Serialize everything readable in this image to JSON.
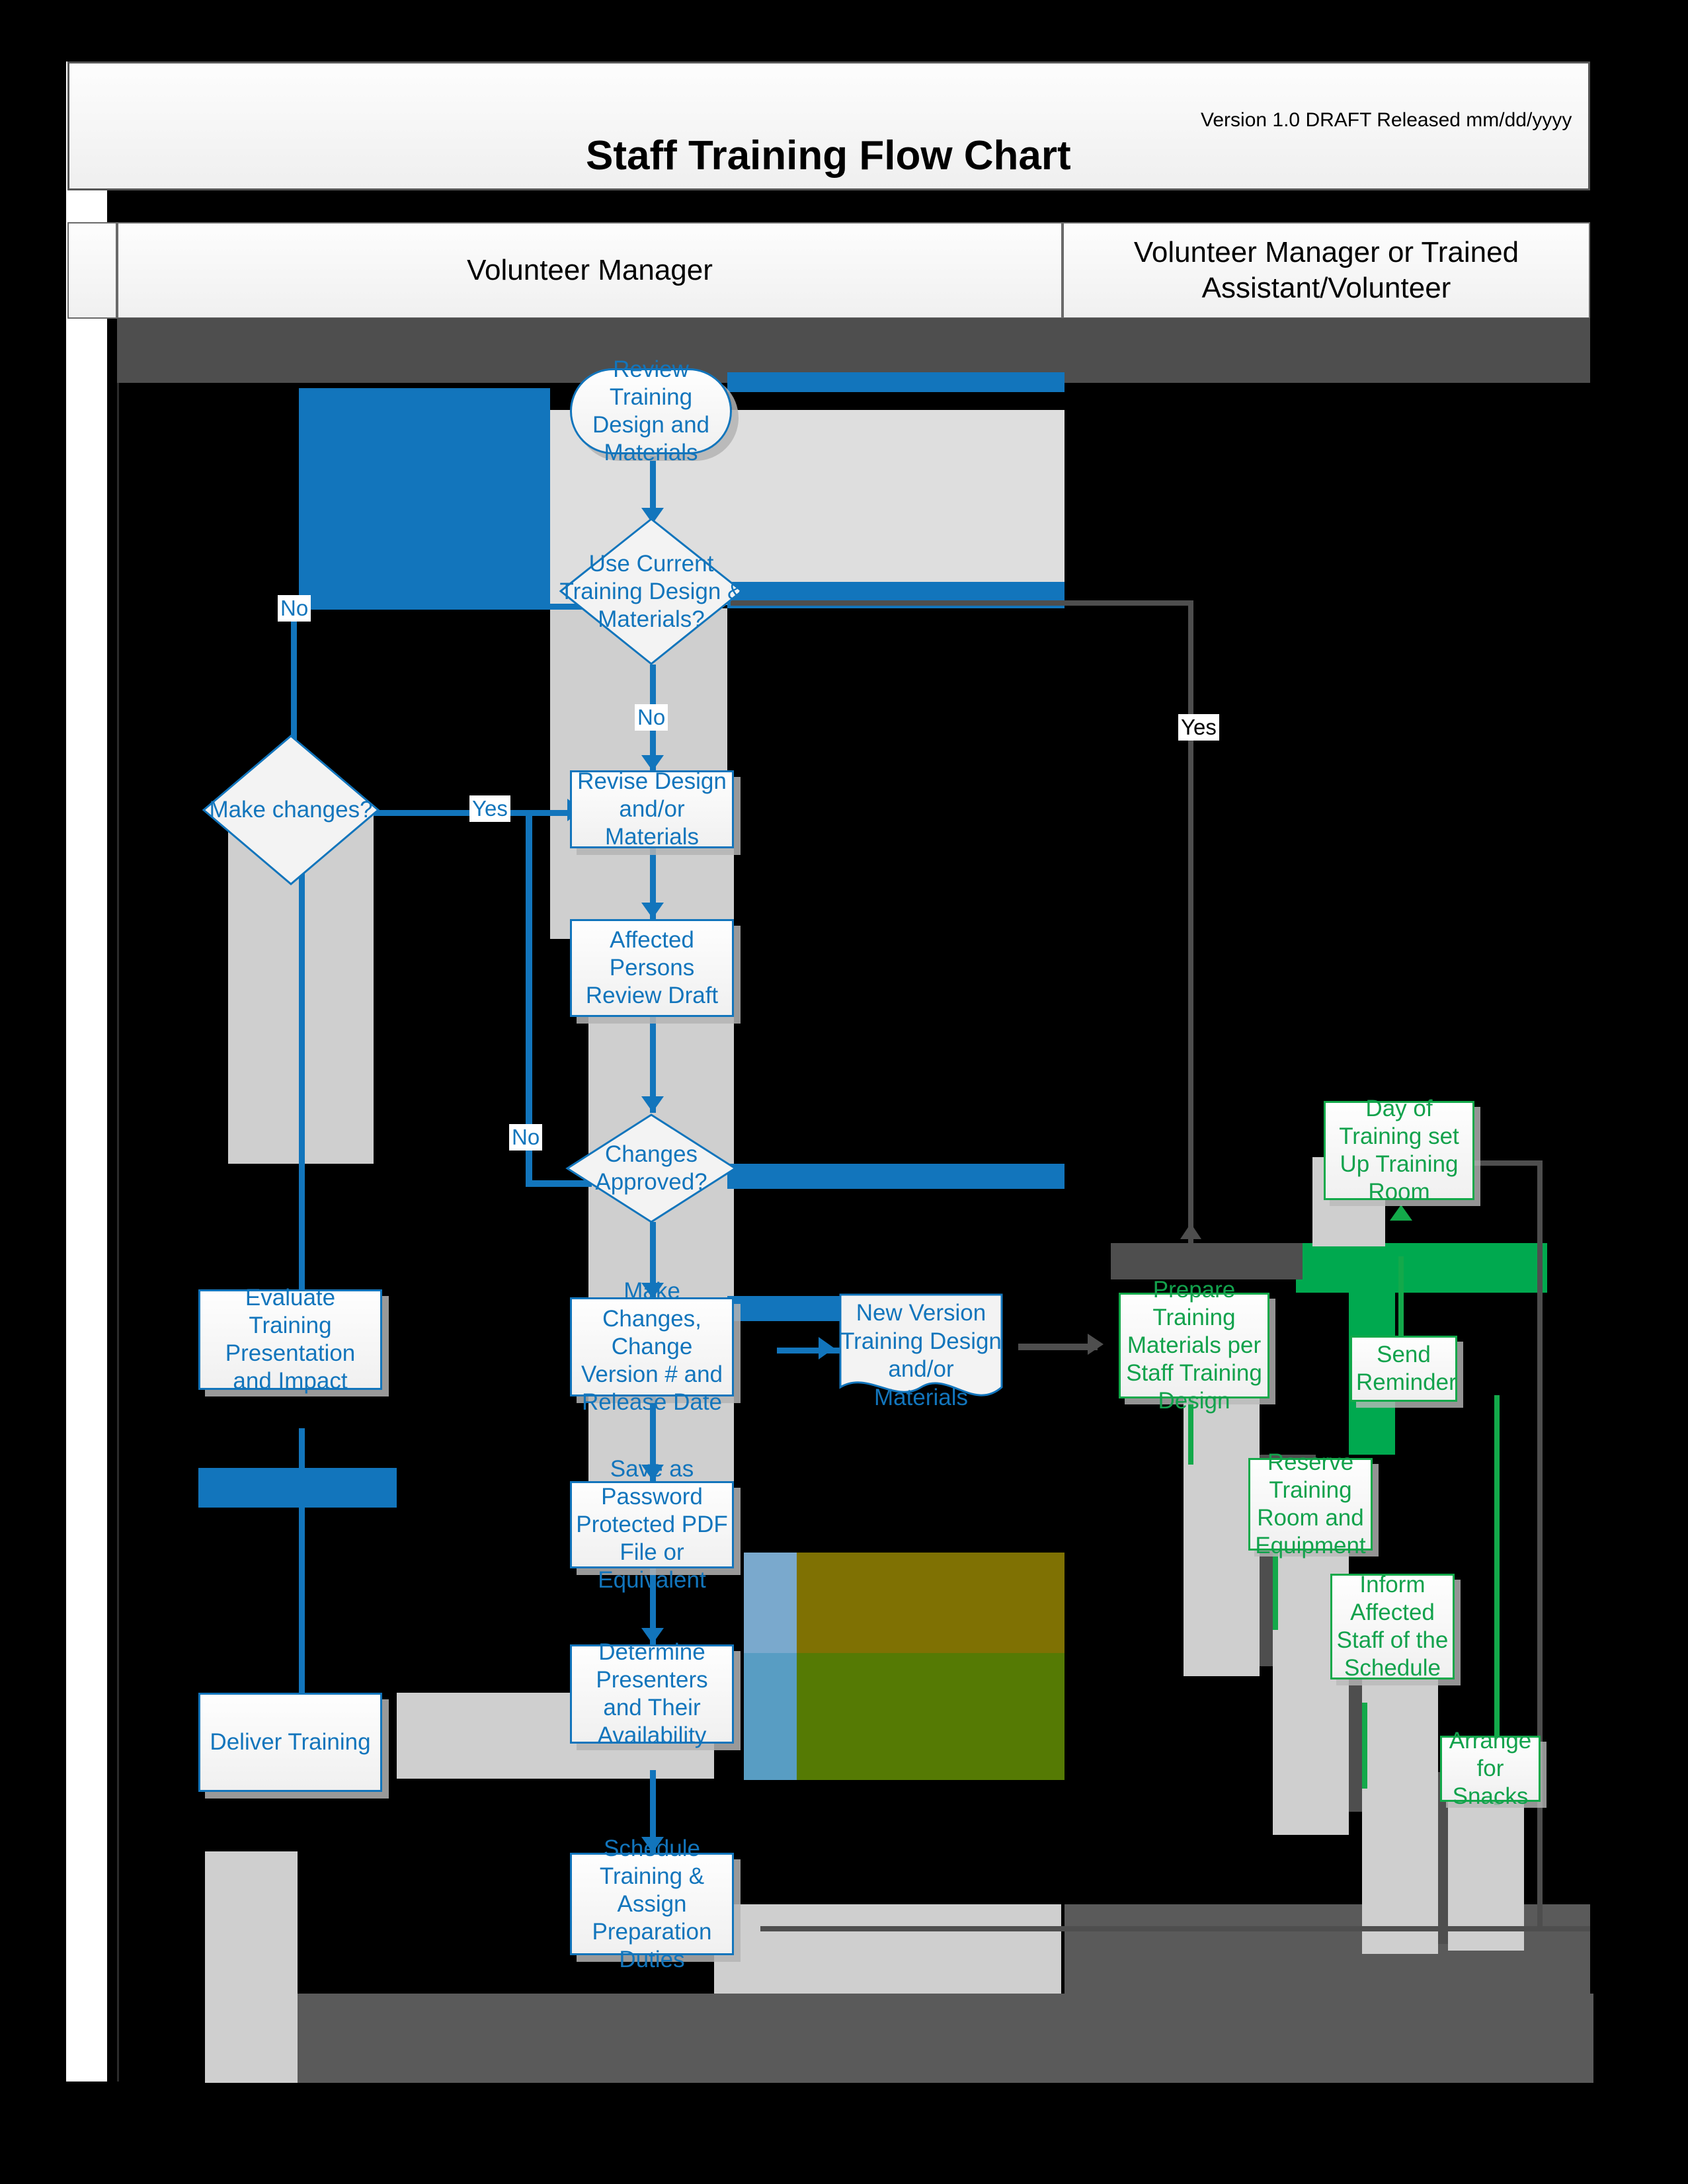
{
  "header": {
    "title": "Staff Training Flow Chart",
    "version": "Version 1.0 DRAFT  Released  mm/dd/yyyy"
  },
  "lanes": [
    {
      "id": "lane-volunteer-manager",
      "label": "Volunteer Manager"
    },
    {
      "id": "lane-volunteer-manager-or-trained-assistant",
      "label": "Volunteer Manager or Trained Assistant/Volunteer"
    }
  ],
  "colors": {
    "blue": "#1275bc",
    "green": "#13a94a",
    "dark_gray": "#4e4e4e",
    "black": "#000000",
    "node_fill": "#f2f2f2"
  },
  "nodes": {
    "review_training": "Review Training Design and Materials",
    "use_current": "Use Current Training Design & Materials?",
    "make_changes": "Make changes?",
    "revise_design": "Revise Design and/or Materials",
    "affected_persons": "Affected Persons Review Draft",
    "changes_approved": "Changes Approved?",
    "evaluate_training": "Evaluate Training Presentation and Impact",
    "make_changes_version": "Make Changes, Change Version # and Release Date",
    "new_version_doc": "New Version Training Design and/or Materials",
    "save_pdf": "Save as Password Protected PDF File or Equivalent",
    "deliver_training": "Deliver Training",
    "determine_presenters": "Determine Presenters and Their Availability",
    "schedule_training": "Schedule Training & Assign Preparation Duties",
    "prepare_materials": "Prepare Training Materials per Staff Training Design",
    "day_of_training": "Day of Training set Up Training Room",
    "send_reminder": "Send Reminder",
    "reserve_room": "Reserve Training Room and Equipment",
    "inform_staff": "Inform Affected Staff of the Schedule",
    "arrange_snacks": "Arrange for Snacks"
  },
  "edge_labels": {
    "no_use_current_left": "No",
    "no_use_current_down": "No",
    "yes_make_changes": "Yes",
    "yes_right_lane": "Yes",
    "no_changes_approved": "No"
  }
}
